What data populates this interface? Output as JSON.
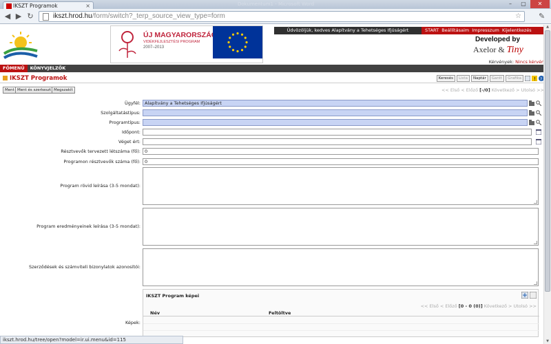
{
  "browser": {
    "tab_title": "IKSZT Programok",
    "tab_close": "×",
    "ghost_title": "Dokumentum1 - Microsoft Word",
    "url_host": "ikszt.hrod.hu",
    "url_path": "/form/switch?_terp_source_view_type=form",
    "status_text": "ikszt.hrod.hu/tree/open?model=ir.ui.menu&id=115",
    "window_controls": [
      "–",
      "▢",
      "✕"
    ]
  },
  "header": {
    "program_title": "ÚJ MAGYARORSZÁG",
    "program_subtitle": "VIDÉKFEJLESZTÉSI PROGRAM",
    "program_years": "2007–2013",
    "welcome": "Üdvözöljük, kedves Alapítvány a Tehetséges Ifjúságért",
    "links": [
      "START",
      "Beállításaim",
      "Impresszum",
      "Kijelentkezés"
    ],
    "developed_by": "Developed by",
    "axelor": "Axelor",
    "amp": "&",
    "tiny": "Tiny",
    "requests_label": "Kérvények:",
    "requests_value": "Nincs kérvény"
  },
  "menu": [
    "FŐMENÜ",
    "KÖNYVJELZŐK"
  ],
  "page": {
    "title": "IKSZT Programok",
    "view_buttons": [
      {
        "label": "Keresés",
        "enabled": true
      },
      {
        "label": "Lista",
        "enabled": false
      },
      {
        "label": "Naptár",
        "enabled": true
      },
      {
        "label": "Gantt",
        "enabled": false
      },
      {
        "label": "Grafika",
        "enabled": false
      }
    ]
  },
  "actions": {
    "save": "Ment",
    "save_edit": "Ment és szerkeszt",
    "cancel": "Megszakít",
    "pager": "<< Első < Előző",
    "pager_count": "[-/0]",
    "pager_next": "Következő > Utolsó >>"
  },
  "form": {
    "client_label": "Ügyfél:",
    "client_value": "Alapítvány a Tehetséges Ifjúságért",
    "service_type_label": "Szolgáltatástípus:",
    "service_type_value": "",
    "program_type_label": "Programtípus:",
    "program_type_value": "",
    "time_label": "Időpont:",
    "time_value": "",
    "end_label": "Véget ért:",
    "end_value": "",
    "planned_participants_label": "Résztvevők tervezett létszáma (fő):",
    "planned_participants_value": "0",
    "actual_participants_label": "Programon résztvevők száma (fő):",
    "actual_participants_value": "0",
    "short_desc_label": "Program rövid leírása (3-5 mondat):",
    "results_desc_label": "Program eredményeinek leírása (3-5 mondat):",
    "contracts_label": "Szerződések és számviteli bizonylatok azonosítói:",
    "images_label": "Képek:"
  },
  "images": {
    "title": "IKSZT Program képei",
    "pager": "<< Első < Előző",
    "pager_count": "[0 - 0 (0)]",
    "pager_next": "Következő > Utolsó >>",
    "col_name": "Név",
    "col_uploaded": "Feltöltve"
  },
  "colors": {
    "accent_red": "#bb1111",
    "required_field": "#c8d4f4",
    "menu_bar": "#424242"
  }
}
